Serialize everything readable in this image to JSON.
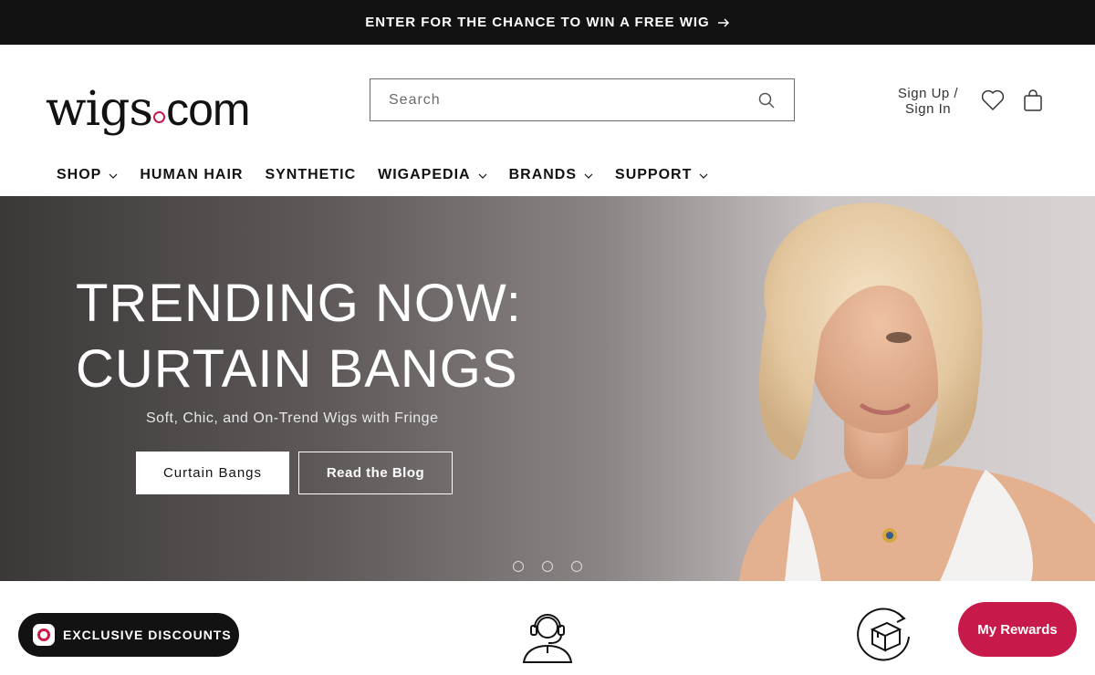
{
  "announcement": {
    "text": "ENTER FOR THE CHANCE TO WIN A FREE WIG",
    "icon": "arrow-right-icon"
  },
  "header": {
    "logo_text": "wigs",
    "logo_domain": "com",
    "search": {
      "placeholder": "Search",
      "value": "",
      "icon": "search-icon"
    },
    "account": {
      "line1": "Sign Up /",
      "line2": "Sign In"
    },
    "wishlist_icon": "heart-icon",
    "cart_icon": "cart-icon"
  },
  "nav": [
    {
      "label": "SHOP",
      "has_dropdown": true
    },
    {
      "label": "HUMAN HAIR",
      "has_dropdown": false
    },
    {
      "label": "SYNTHETIC",
      "has_dropdown": false
    },
    {
      "label": "WIGAPEDIA",
      "has_dropdown": true
    },
    {
      "label": "BRANDS",
      "has_dropdown": true
    },
    {
      "label": "SUPPORT",
      "has_dropdown": true
    }
  ],
  "hero": {
    "title_line1": "TRENDING NOW:",
    "title_line2": "CURTAIN BANGS",
    "subtitle": "Soft, Chic, and On-Trend Wigs with Fringe",
    "primary_button": "Curtain Bangs",
    "secondary_button": "Read the Blog",
    "slide_count": 3
  },
  "features": {
    "icons": [
      "headset-support-icon",
      "box-return-icon"
    ]
  },
  "popups": {
    "discount_label": "EXCLUSIVE DISCOUNTS",
    "rewards_label": "My Rewards"
  },
  "colors": {
    "brand": "#c8194b",
    "dark": "#121212"
  }
}
